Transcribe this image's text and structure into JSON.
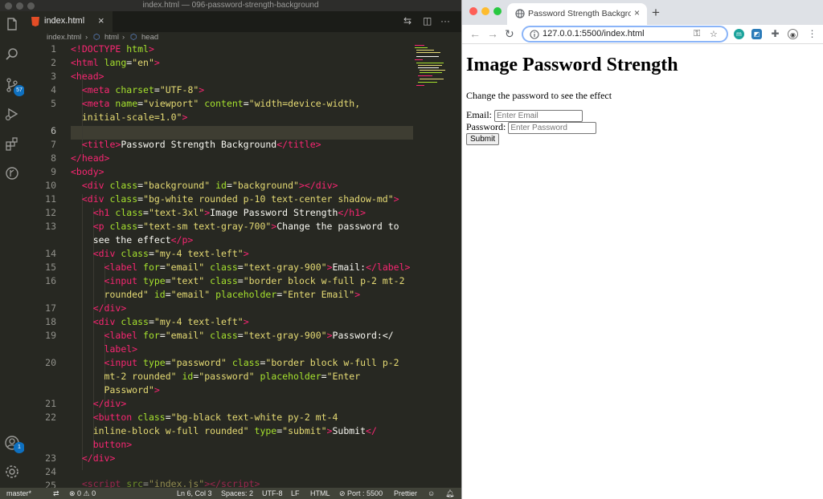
{
  "vscode": {
    "window_title": "index.html — 096-password-strength-background",
    "tab": {
      "label": "index.html",
      "close": "×"
    },
    "tab_tools": {
      "compare": "⇆",
      "split": "◫",
      "more": "···"
    },
    "breadcrumb": {
      "file": "index.html",
      "sep1": "›",
      "html": "html",
      "sep2": "›",
      "head": "head"
    },
    "activity_badges": {
      "scm": "57",
      "account": "1"
    },
    "status": {
      "branch": "master*",
      "problems": "⊗ 0 ⚠ 0",
      "position": "Ln 6, Col 3",
      "spaces": "Spaces: 2",
      "encoding": "UTF-8",
      "eol": "LF",
      "language": "HTML",
      "port": "⊘ Port : 5500",
      "formatter": "Prettier"
    },
    "line_numbers": [
      "1",
      "2",
      "3",
      "4",
      "5",
      "",
      "6",
      "7",
      "8",
      "9",
      "10",
      "11",
      "12",
      "13",
      "",
      "14",
      "15",
      "16",
      "",
      "17",
      "18",
      "19",
      "",
      "20",
      "",
      "",
      "21",
      "22",
      "",
      "",
      "23",
      "24",
      "25"
    ]
  },
  "browser": {
    "tab_title": "Password Strength Background",
    "new_tab": "+",
    "tab_close": "×",
    "url": "127.0.0.1:5500/index.html",
    "nav": {
      "back": "←",
      "forward": "→",
      "reload": "↻"
    },
    "page": {
      "heading": "Image Password Strength",
      "subtitle": "Change the password to see the effect",
      "email_label": "Email:",
      "email_placeholder": "Enter Email",
      "password_label": "Password:",
      "password_placeholder": "Enter Password",
      "submit_label": "Submit"
    }
  },
  "colors": {
    "editor_bg": "#272822",
    "tag": "#f92672",
    "attr": "#a6e22e",
    "string": "#e6db74",
    "text": "#f8f8f2",
    "status_bar": "#414339",
    "omnibox_focus": "#8ab4f8"
  }
}
